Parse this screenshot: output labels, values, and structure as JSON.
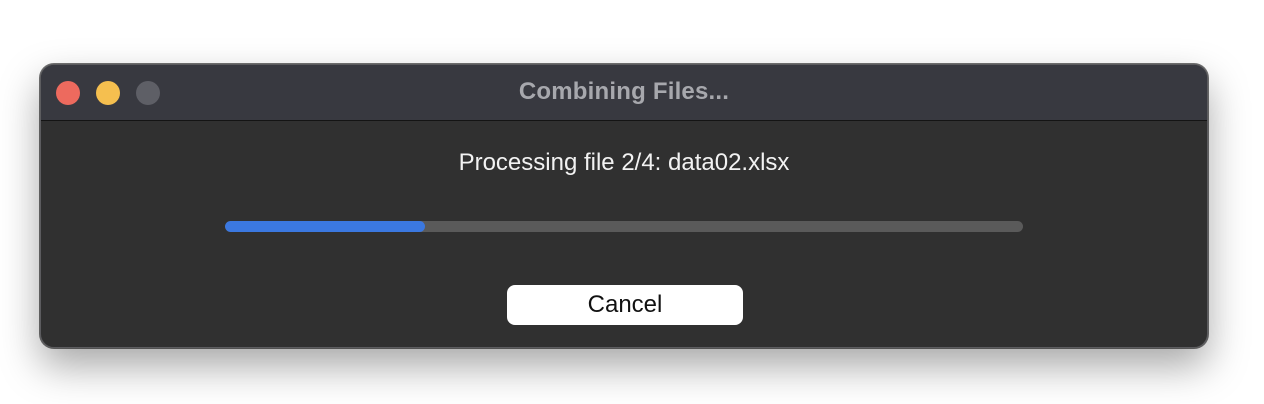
{
  "window": {
    "title": "Combining Files..."
  },
  "content": {
    "status_text": "Processing file 2/4: data02.xlsx",
    "progress_fraction": 0.25,
    "cancel_label": "Cancel"
  },
  "colors": {
    "close": "#ed6a5e",
    "minimize": "#f5bf4f",
    "zoom_disabled": "#5e5f66",
    "progress_fill": "#3b78e0",
    "progress_track": "#5a5a5a",
    "window_bg": "#303030",
    "titlebar_bg": "#383940"
  }
}
